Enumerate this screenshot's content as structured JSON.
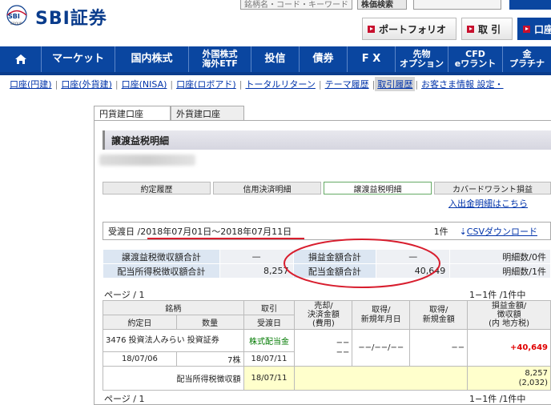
{
  "header": {
    "logo_mark": "SBI",
    "logo_group": "GROUP",
    "logo_text": "SBI証券",
    "top_inputs": [
      "銘柄名・コード・キーワード",
      "株価検索"
    ],
    "portfolio_label": "ポートフォリオ",
    "trade_label": "取 引",
    "account_label": "口座"
  },
  "nav": {
    "home_icon": "home-icon",
    "items": [
      {
        "label": "マーケット"
      },
      {
        "label": "国内株式"
      },
      {
        "label": "外国株式\n海外ETF"
      },
      {
        "label": "投信"
      },
      {
        "label": "債券"
      },
      {
        "label": "F X"
      },
      {
        "label": "先物\nオプション"
      },
      {
        "label": "CFD\neワラント"
      },
      {
        "label": "金\nプラチナ"
      }
    ]
  },
  "subnav": {
    "items": [
      "口座(円建)",
      "口座(外貨建)",
      "口座(NISA)",
      "口座(ロボアド)",
      "トータルリターン",
      "テーマ履歴",
      "取引履歴",
      "お客さま情報 設定・"
    ],
    "active_index": 6
  },
  "tabs": {
    "yen": "円貨建口座",
    "foreign": "外貨建口座"
  },
  "title": "譲渡益税明細",
  "subtabs": [
    "約定履歴",
    "信用決済明細",
    "譲渡益税明細",
    "カバードワラント損益"
  ],
  "cash_link": "入出金明細はこちら",
  "period": {
    "label": "受渡日 / ",
    "range": "2018年07月01日～2018年07月11日",
    "count": "1件",
    "csv_label": "CSVダウンロード"
  },
  "summary": {
    "rows": [
      {
        "l1": "譲渡益税徴収額合計",
        "v1": "—",
        "l2": "損益金額合計",
        "v2": "—",
        "l3": "明細数/0件"
      },
      {
        "l1": "配当所得税徴収額合計",
        "v1": "8,257",
        "l2": "配当金額合計",
        "v2": "40,649",
        "l3": "明細数/1件"
      }
    ]
  },
  "pager": {
    "page": "ページ / 1",
    "range": "1−1件 /1件中"
  },
  "detail": {
    "headers": {
      "meigara": "銘柄",
      "torihiki": "取引",
      "baikyaku": "売却/\n決済金額\n(費用)",
      "shutoku_date": "取得/\n新規年月日",
      "shutoku_amt": "取得/\n新規金額",
      "soneki": "損益金額/\n徴収額\n(内 地方税)",
      "yakujo": "約定日",
      "suryo": "数量",
      "ukewatashi": "受渡日"
    },
    "row": {
      "name": "3476 投資法人みらい 投資証券",
      "kind": "株式配当金",
      "sell1": "−−",
      "sell2": "−−",
      "acq_date": "−−/−−/−−",
      "acq_amt": "−−",
      "profit": "+40,649",
      "date": "18/07/06",
      "qty": "7株",
      "settle": "18/07/11"
    },
    "footer": {
      "label": "配当所得税徴収額",
      "date": "18/07/11",
      "tax": "8,257",
      "local": "(2,032)"
    }
  },
  "colors": {
    "nav_bg": "#0a46a0",
    "annotation_red": "#d81e2e",
    "profit_red": "#e00000"
  }
}
